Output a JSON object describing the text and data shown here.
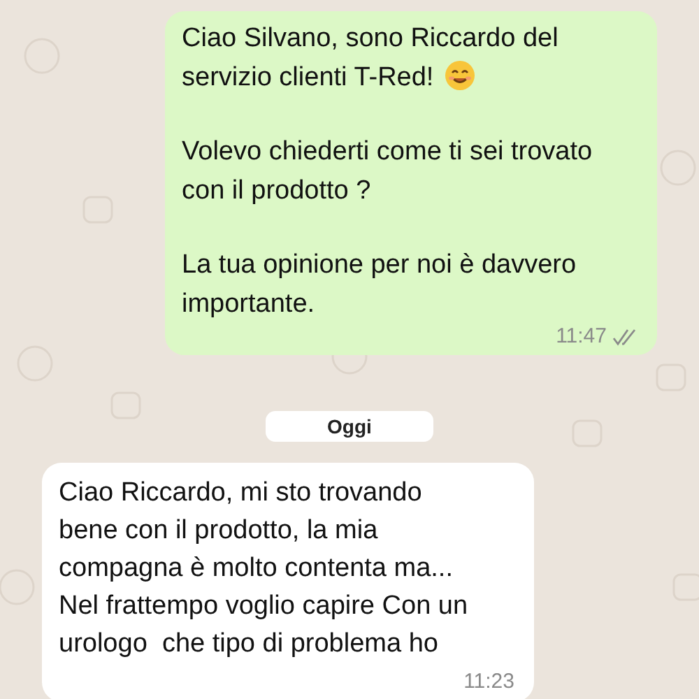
{
  "messages": [
    {
      "kind": "outgoing",
      "paragraphs": [
        {
          "lines": [
            "Ciao Silvano, sono Riccardo del",
            "servizio clienti T-Red!"
          ],
          "emoji": true
        },
        {
          "lines": [
            "Volevo chiederti come ti sei trovato",
            "con il prodotto ?"
          ],
          "emoji": false
        },
        {
          "lines": [
            "La tua opinione per noi è davvero",
            "importante."
          ],
          "emoji": false
        }
      ],
      "time": "11:47",
      "read": false
    },
    {
      "kind": "date",
      "label": "Oggi"
    },
    {
      "kind": "incoming",
      "paragraphs": [
        {
          "lines": [
            "Ciao Riccardo, mi sto trovando",
            "bene con il prodotto, la mia",
            "compagna è molto contenta ma...",
            "Nel frattempo voglio capire Con un",
            "urologo  che tipo di problema ho"
          ],
          "emoji": false
        }
      ],
      "time": "11:23"
    }
  ]
}
